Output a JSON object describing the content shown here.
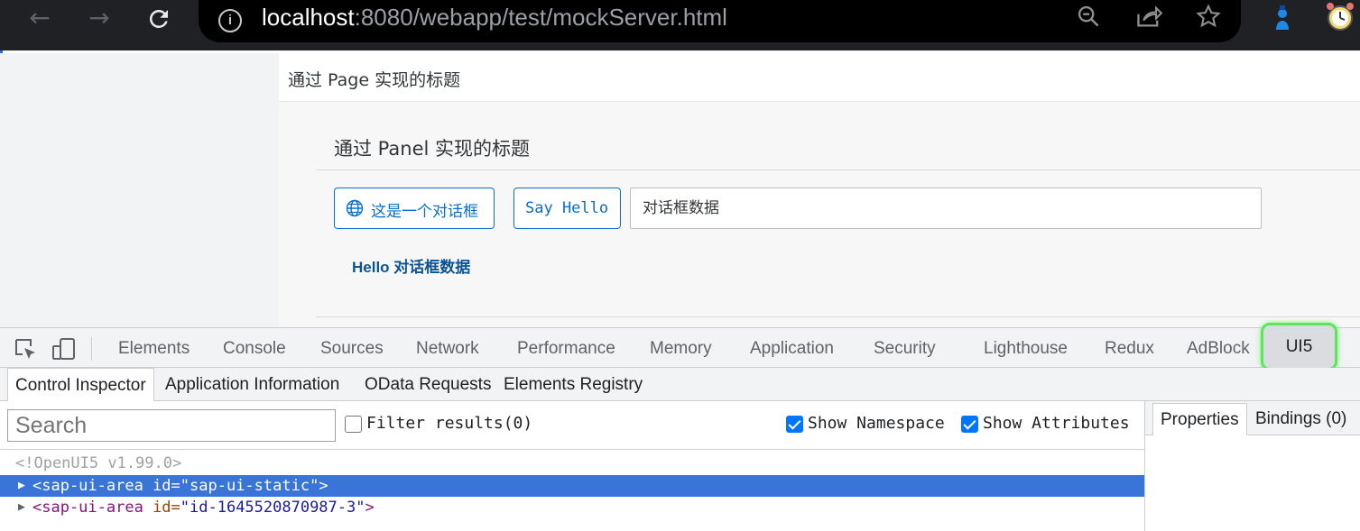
{
  "browser": {
    "url_host": "localhost",
    "url_rest": ":8080/webapp/test/mockServer.html",
    "icons": [
      "back-icon",
      "forward-icon",
      "reload-icon",
      "info-icon",
      "zoom-icon",
      "share-icon",
      "star-icon",
      "extension-icon",
      "alarm-icon"
    ]
  },
  "page": {
    "title": "通过 Page 实现的标题",
    "panel_title": "通过 Panel 实现的标题",
    "dialog_button": "这是一个对话框",
    "hello_button": "Say Hello",
    "input_value": "对话框数据",
    "hello_text": "Hello 对话框数据"
  },
  "devtools": {
    "tabs": [
      "Elements",
      "Console",
      "Sources",
      "Network",
      "Performance",
      "Memory",
      "Application",
      "Security",
      "Lighthouse",
      "Redux",
      "AdBlock",
      "UI5"
    ],
    "active_tab": "UI5",
    "subtabs": [
      "Control Inspector",
      "Application Information",
      "OData Requests",
      "Elements Registry"
    ],
    "active_subtab": "Control Inspector",
    "search_placeholder": "Search",
    "filter_label": "Filter results(0)",
    "filter_checked": false,
    "show_namespace_label": "Show Namespace",
    "show_namespace_checked": true,
    "show_attributes_label": "Show Attributes",
    "show_attributes_checked": true,
    "side_tabs": [
      "Properties",
      "Bindings (0)"
    ],
    "tree": {
      "comment": "<!OpenUI5 v1.99.0>",
      "rows": [
        {
          "tag": "<sap-ui-area",
          "attr": " id=",
          "value": "\"sap-ui-static\"",
          "close": ">"
        },
        {
          "tag": "<sap-ui-area",
          "attr": " id=",
          "value": "\"id-1645520870987-3\"",
          "close": ">"
        }
      ]
    },
    "accent": "#3875d7",
    "highlight": "#5ce65c"
  }
}
